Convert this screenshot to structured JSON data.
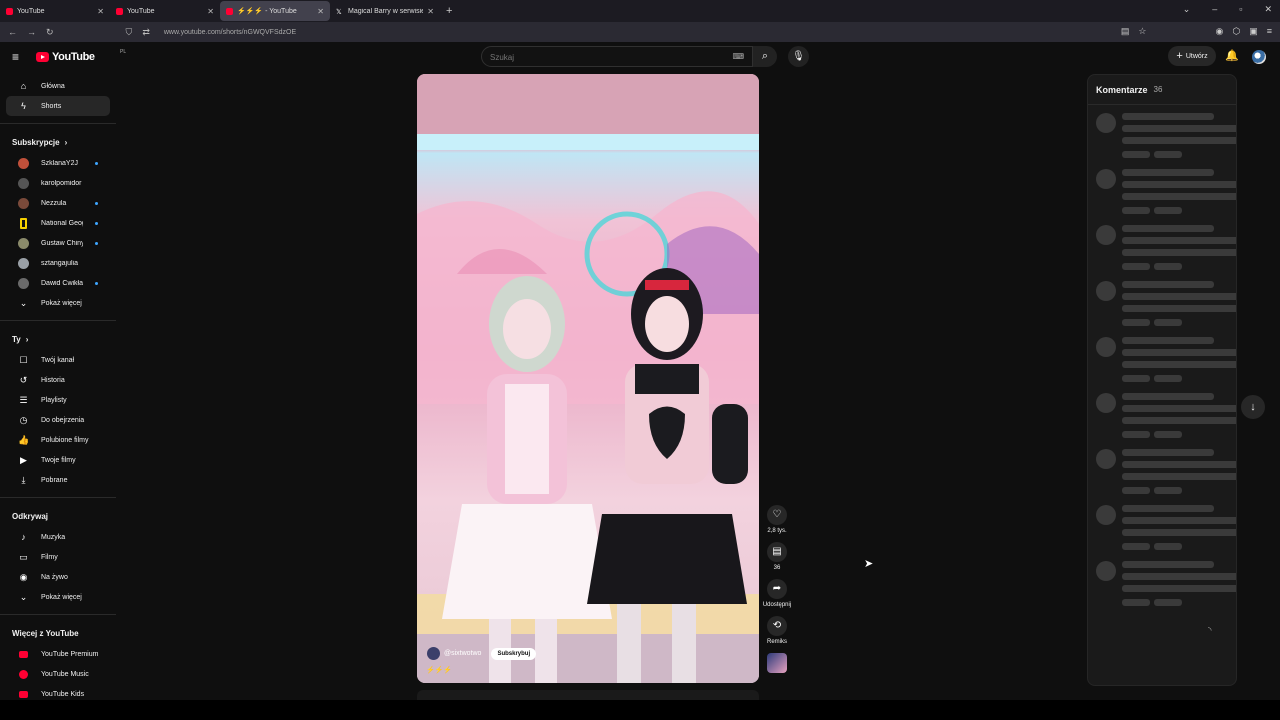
{
  "browser": {
    "tabs": [
      {
        "title": "YouTube",
        "favicon": "youtube-icon",
        "active": false
      },
      {
        "title": "YouTube",
        "favicon": "youtube-icon",
        "active": false
      },
      {
        "title": "⚡⚡⚡ - YouTube",
        "favicon": "youtube-icon",
        "active": true
      },
      {
        "title": "Magical Barry w serwisie X: „Ha",
        "favicon": "x-icon",
        "active": false
      }
    ],
    "url": "www.youtube.com/shorts/nGWQVFSdzOE"
  },
  "masthead": {
    "logo_text": "YouTube",
    "logo_region": "PL",
    "search_placeholder": "Szukaj",
    "create_label": "Utwórz"
  },
  "sidebar": {
    "main": [
      {
        "label": "Główna",
        "icon": "home-icon"
      },
      {
        "label": "Shorts",
        "icon": "shorts-icon",
        "active": true
      }
    ],
    "subscriptions_title": "Subskrypcje",
    "subscriptions": [
      {
        "label": "SzklanaY2J",
        "avatar_color": "#c0503a",
        "new": true
      },
      {
        "label": "karolpomidor",
        "avatar_color": "#555555",
        "new": false
      },
      {
        "label": "Nezzula",
        "avatar_color": "#7a4a3a",
        "new": true
      },
      {
        "label": "National Geogra...",
        "avatar_color": "#f5d000",
        "new": true
      },
      {
        "label": "Gustaw Chiny",
        "avatar_color": "#8a8a6a",
        "new": true
      },
      {
        "label": "sztangajulia",
        "avatar_color": "#9aa0a6",
        "new": false
      },
      {
        "label": "Dawid Ćwikła",
        "avatar_color": "#6a6a6a",
        "new": true
      }
    ],
    "subs_more": "Pokaż więcej",
    "you_title": "Ty",
    "you": [
      {
        "label": "Twój kanał",
        "icon": "user-icon"
      },
      {
        "label": "Historia",
        "icon": "history-icon"
      },
      {
        "label": "Playlisty",
        "icon": "playlist-icon"
      },
      {
        "label": "Do obejrzenia",
        "icon": "clock-icon"
      },
      {
        "label": "Polubione filmy",
        "icon": "thumbs-up-icon"
      },
      {
        "label": "Twoje filmy",
        "icon": "video-icon"
      },
      {
        "label": "Pobrane",
        "icon": "download-icon"
      }
    ],
    "explore_title": "Odkrywaj",
    "explore": [
      {
        "label": "Muzyka",
        "icon": "music-icon"
      },
      {
        "label": "Filmy",
        "icon": "film-icon"
      },
      {
        "label": "Na żywo",
        "icon": "live-icon"
      },
      {
        "label": "Pokaż więcej",
        "icon": "chevron-down-icon"
      }
    ],
    "more_title": "Więcej z YouTube",
    "more": [
      {
        "label": "YouTube Premium"
      },
      {
        "label": "YouTube Music"
      },
      {
        "label": "YouTube Kids"
      }
    ]
  },
  "short": {
    "channel": "@sixtwotwo",
    "subscribe_label": "Subskrybuj",
    "caption": "⚡⚡⚡"
  },
  "actions": {
    "likes": "2,8 tys.",
    "comments": "36",
    "share": "Udostępnij",
    "remix": "Remiks"
  },
  "comments_panel": {
    "title": "Komentarze",
    "count": "36"
  },
  "colors": {
    "accent": "#ff0033",
    "background": "#0f0f0f",
    "new_dot": "#3ea6ff"
  }
}
